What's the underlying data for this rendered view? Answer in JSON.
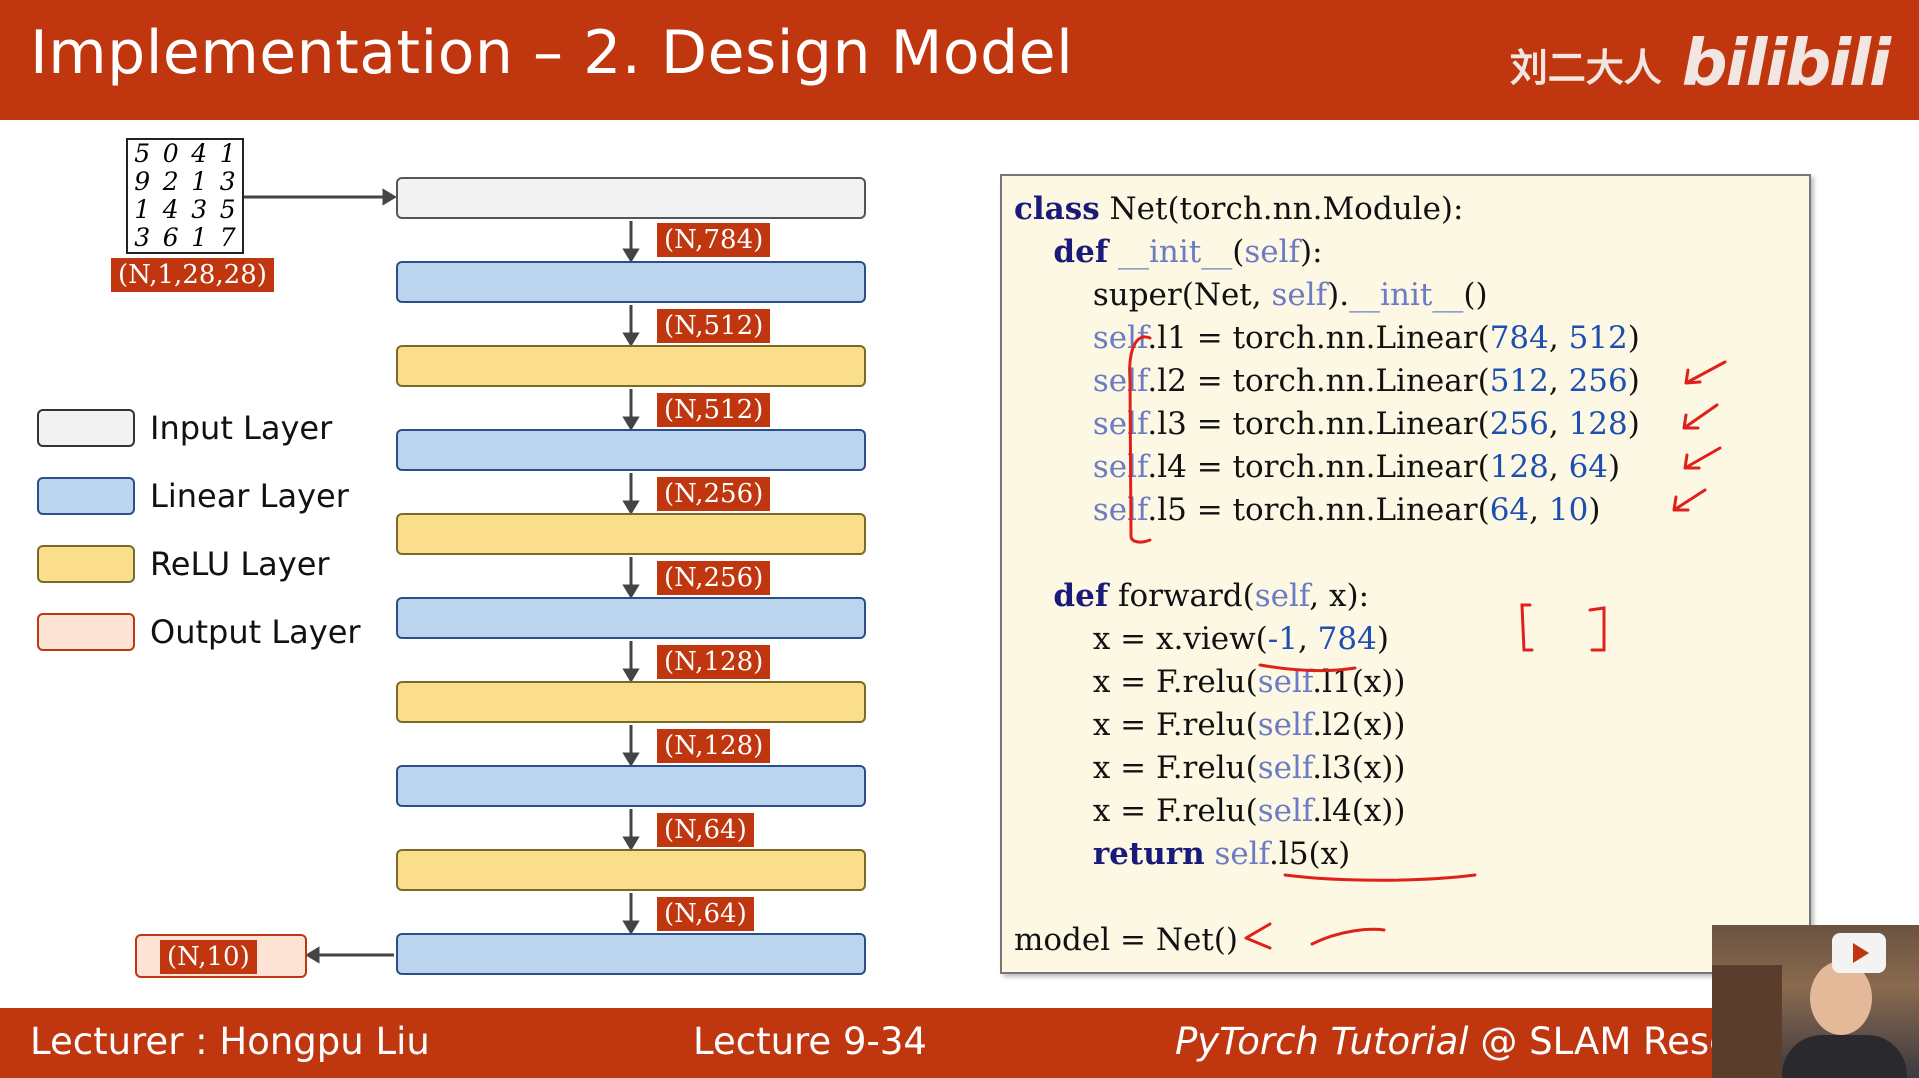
{
  "header": {
    "title": "Implementation – 2. Design Model",
    "brand_cn": "刘二大人",
    "brand_logo": "bilibili"
  },
  "input_image": {
    "digits": [
      "5",
      "0",
      "4",
      "1",
      "9",
      "2",
      "1",
      "3",
      "1",
      "4",
      "3",
      "5",
      "3",
      "6",
      "1",
      "7"
    ],
    "shape": "(N,1,28,28)"
  },
  "shapes": [
    "(N,784)",
    "(N,512)",
    "(N,512)",
    "(N,256)",
    "(N,256)",
    "(N,128)",
    "(N,128)",
    "(N,64)",
    "(N,64)"
  ],
  "output_shape": "(N,10)",
  "legend": [
    {
      "label": "Input Layer",
      "color": "#f2f2f2"
    },
    {
      "label": "Linear Layer",
      "color": "#bcd5ef"
    },
    {
      "label": "ReLU Layer",
      "color": "#fbde8c"
    },
    {
      "label": "Output Layer",
      "color": "#fde3d5"
    }
  ],
  "code": {
    "l1_kw": "class",
    "l1": " Net(torch.nn.Module):",
    "l2_kw": "def",
    "l2a": " ",
    "l2b": "__init__",
    "l2c": "(",
    "l2d": "self",
    "l2e": "):",
    "l3a": "super(Net, ",
    "l3b": "self",
    "l3c": ").",
    "l3d": "__init__",
    "l3e": "()",
    "lin": [
      {
        "self": "self",
        "attr": ".l1 = torch.nn.Linear(",
        "a": "784",
        "sep": ", ",
        "b": "512",
        "end": ")"
      },
      {
        "self": "self",
        "attr": ".l2 = torch.nn.Linear(",
        "a": "512",
        "sep": ", ",
        "b": "256",
        "end": ")"
      },
      {
        "self": "self",
        "attr": ".l3 = torch.nn.Linear(",
        "a": "256",
        "sep": ", ",
        "b": "128",
        "end": ")"
      },
      {
        "self": "self",
        "attr": ".l4 = torch.nn.Linear(",
        "a": "128",
        "sep": ", ",
        "b": "64",
        "end": ")"
      },
      {
        "self": "self",
        "attr": ".l5 = torch.nn.Linear(",
        "a": "64",
        "sep": ", ",
        "b": "10",
        "end": ")"
      }
    ],
    "f_kw": "def",
    "f1": " forward(",
    "f2": "self",
    "f3": ", x):",
    "v1": "x = x.view(",
    "v2": "-1",
    "v3": ", ",
    "v4": "784",
    "v5": ")",
    "relu": [
      {
        "pre": "x = F.relu(",
        "self": "self",
        "post": ".l1(x))"
      },
      {
        "pre": "x = F.relu(",
        "self": "self",
        "post": ".l2(x))"
      },
      {
        "pre": "x = F.relu(",
        "self": "self",
        "post": ".l3(x))"
      },
      {
        "pre": "x = F.relu(",
        "self": "self",
        "post": ".l4(x))"
      }
    ],
    "r_kw": "return",
    "r1": " ",
    "r2": "self",
    "r3": ".l5(x)",
    "model": "model = Net()"
  },
  "footer": {
    "lecturer": "Lecturer : Hongpu Liu",
    "lecture": "Lecture 9-34",
    "tutorial_italic": "PyTorch Tutorial",
    "tutorial_rest": " @ SLAM Resea"
  },
  "colors": {
    "accent": "#c0360f",
    "ink_annotation": "#e0201a"
  }
}
